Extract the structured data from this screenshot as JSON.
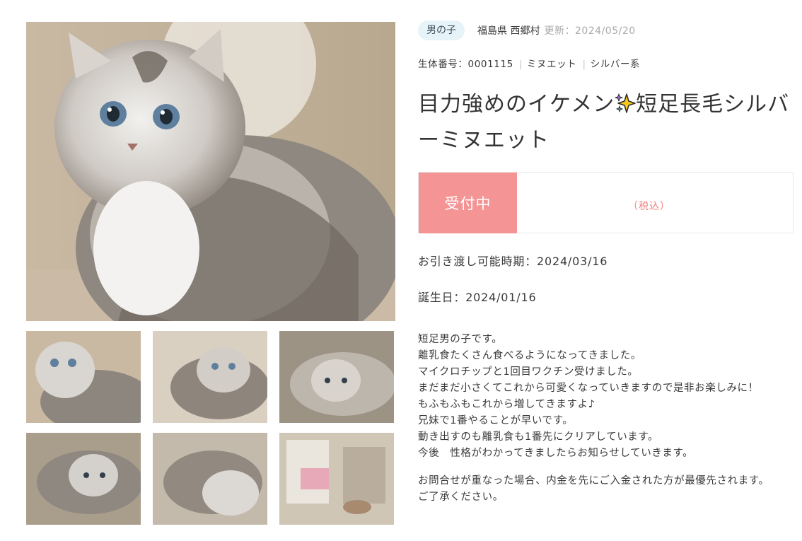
{
  "badge": "男の子",
  "location": "福島県 西郷村",
  "updated": "更新：2024/05/20",
  "details": {
    "id": "生体番号：0001115",
    "breed": "ミヌエット",
    "color": "シルバー系"
  },
  "title_before": "目力強めのイケメン",
  "title_after": "短足長毛シルバーミヌエット",
  "sparkle_icon": "sparkles-icon",
  "status": "受付中",
  "tax_label": "（税込）",
  "handover": "お引き渡し可能時期：2024/03/16",
  "birthday": "誕生日：2024/01/16",
  "description": [
    "短足男の子です。",
    "離乳食たくさん食べるようになってきました。",
    "マイクロチップと1回目ワクチン受けました。",
    "まだまだ小さくてこれから可愛くなっていきますので是非お楽しみに！",
    "もふもふもこれから増してきますよ♪",
    "兄妹で1番やることが早いです。",
    "動き出すのも離乳食も1番先にクリアしています。",
    "今後　性格がわかってきましたらお知らせしていきます。"
  ],
  "notice": [
    "お問合せが重なった場合、内金を先にご入金された方が最優先されます。",
    "ご了承ください。"
  ],
  "colors": {
    "status_bg": "#f49494",
    "badge_bg": "#e6f3f9",
    "tax_text": "#f08080"
  },
  "gallery": {
    "main": "main-kitten-photo",
    "thumbnails": [
      "thumbnail-1",
      "thumbnail-2",
      "thumbnail-3",
      "thumbnail-4",
      "thumbnail-5",
      "thumbnail-6"
    ]
  }
}
